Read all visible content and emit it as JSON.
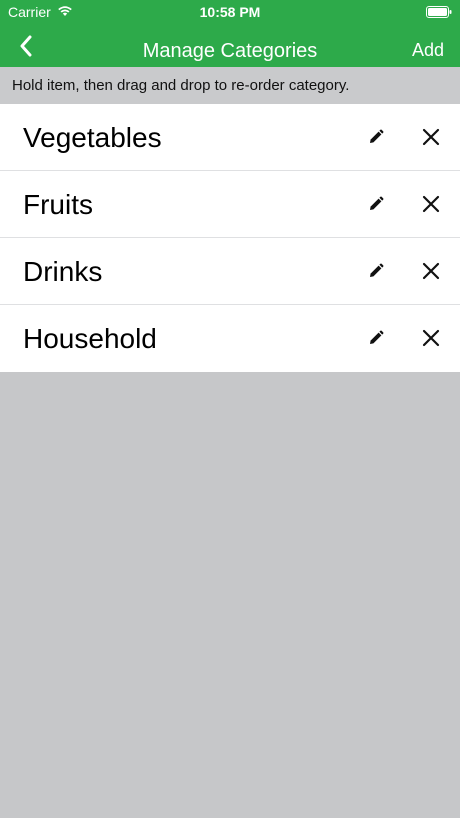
{
  "status": {
    "carrier": "Carrier",
    "time": "10:58 PM"
  },
  "nav": {
    "title": "Manage Categories",
    "add_label": "Add"
  },
  "hint": "Hold item, then drag and drop to re-order category.",
  "categories": [
    {
      "label": "Vegetables"
    },
    {
      "label": "Fruits"
    },
    {
      "label": "Drinks"
    },
    {
      "label": "Household"
    }
  ],
  "colors": {
    "brand_green": "#2daa4a",
    "background": "#c6c7c9"
  },
  "icons": {
    "back": "chevron-left-icon",
    "edit": "pencil-icon",
    "delete": "close-icon",
    "wifi": "wifi-icon",
    "battery": "battery-icon"
  }
}
